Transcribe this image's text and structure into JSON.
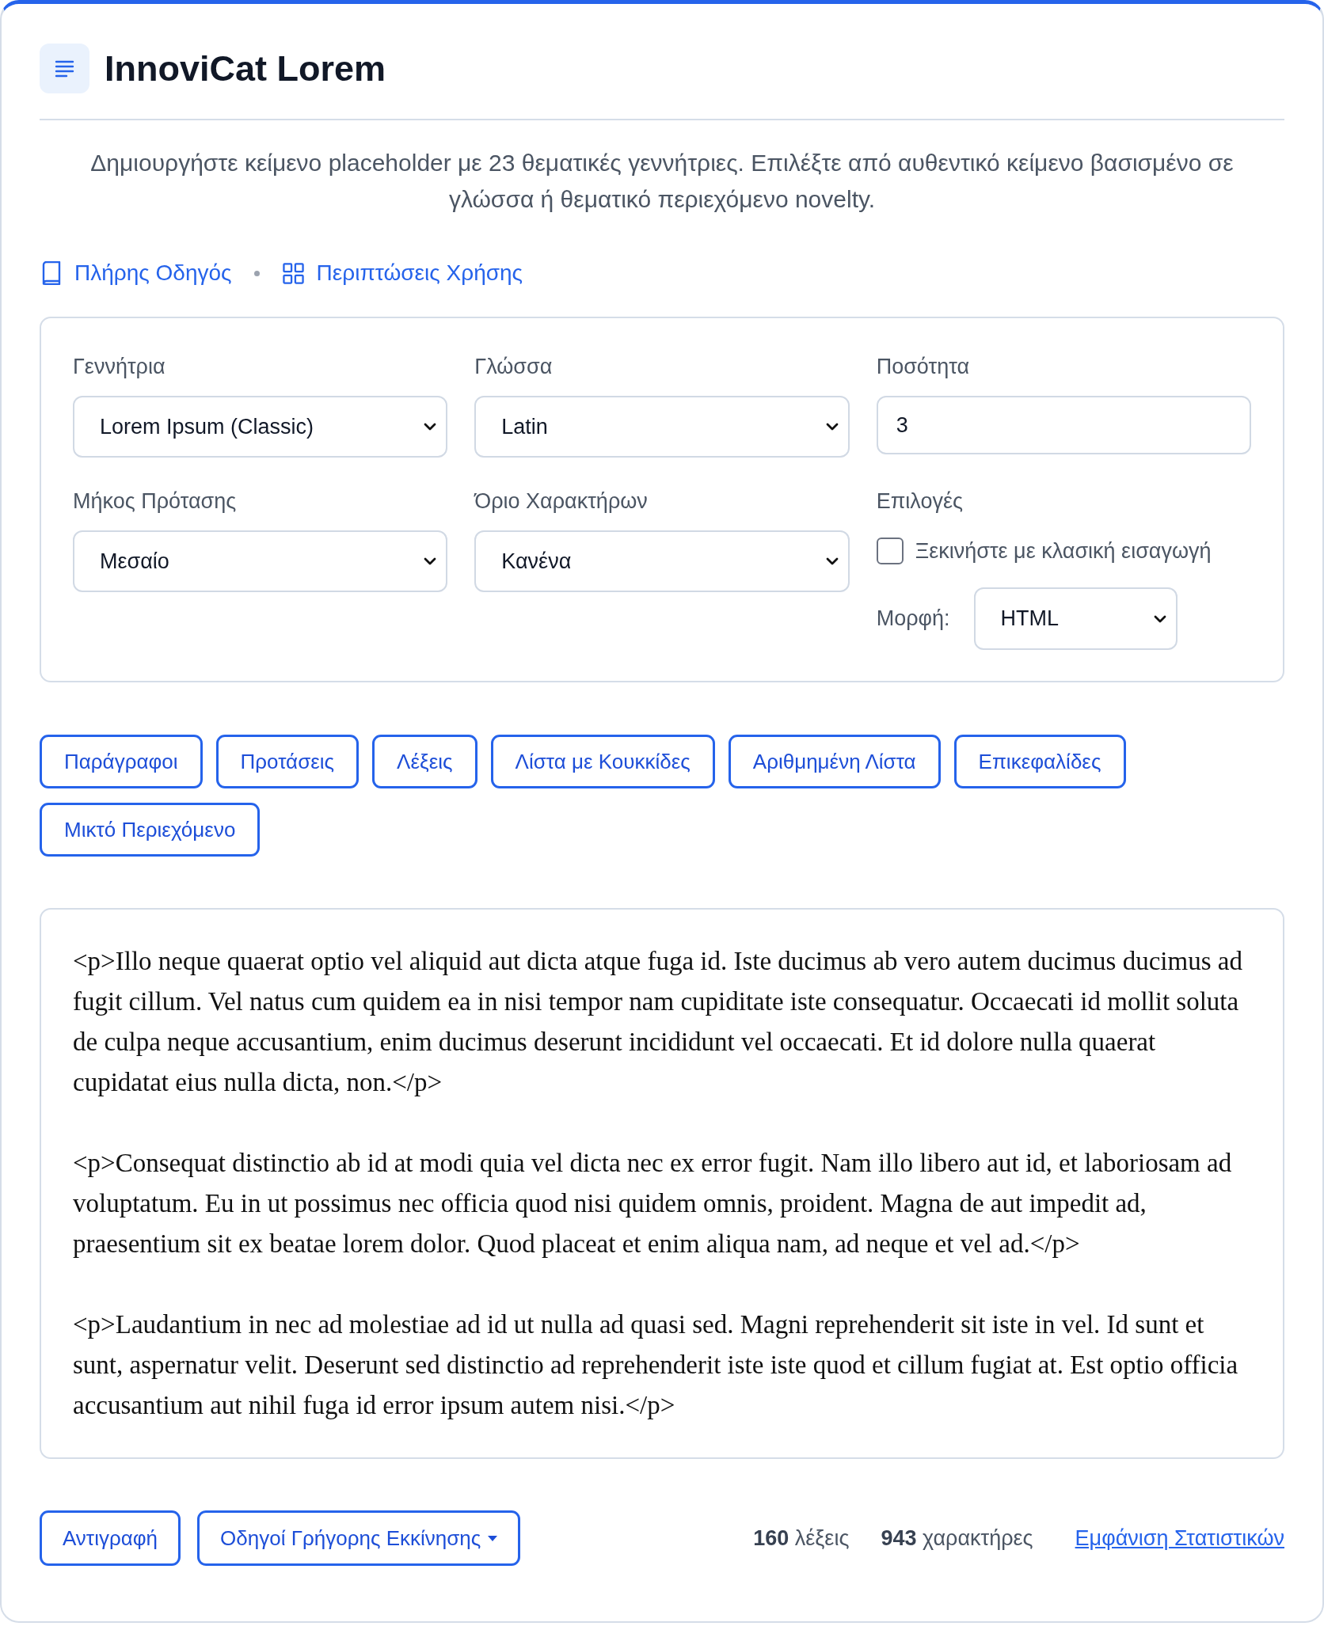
{
  "header": {
    "title": "InnoviCat Lorem"
  },
  "description": "Δημιουργήστε κείμενο placeholder με 23 θεματικές γεννήτριες. Επιλέξτε από αυθεντικό κείμενο βασισμένο σε γλώσσα ή θεματικό περιεχόμενο novelty.",
  "links": [
    {
      "kind": "guide",
      "label": "Πλήρης Οδηγός"
    },
    {
      "kind": "cases",
      "label": "Περιπτώσεις Χρήσης"
    }
  ],
  "settings": {
    "fields": [
      {
        "kind": "select",
        "label": "Γεννήτρια",
        "value": "Lorem Ipsum (Classic)"
      },
      {
        "kind": "select",
        "label": "Γλώσσα",
        "value": "Latin"
      },
      {
        "kind": "number",
        "label": "Ποσότητα",
        "value": "3"
      },
      {
        "kind": "select",
        "label": "Μήκος Πρότασης",
        "value": "Μεσαίο"
      },
      {
        "kind": "select",
        "label": "Όριο Χαρακτήρων",
        "value": "Κανένα"
      },
      {
        "kind": "options",
        "label": "Επιλογές",
        "checkbox": {
          "label": "Ξεκινήστε με κλασική εισαγωγή",
          "checked": false
        },
        "format": {
          "label": "Μορφή:",
          "value": "HTML"
        }
      }
    ]
  },
  "generate_buttons": [
    "Παράγραφοι",
    "Προτάσεις",
    "Λέξεις",
    "Λίστα με Κουκκίδες",
    "Αριθμημένη Λίστα",
    "Επικεφαλίδες",
    "Μικτό Περιεχόμενο"
  ],
  "output": {
    "paragraphs": [
      "<p>Illo neque quaerat optio vel aliquid aut dicta atque fuga id. Iste ducimus ab vero autem ducimus ducimus ad fugit cillum. Vel natus cum quidem ea in nisi tempor nam cupiditate iste consequatur. Occaecati id mollit soluta de culpa neque accusantium, enim ducimus deserunt incididunt vel occaecati. Et id dolore nulla quaerat cupidatat eius nulla dicta, non.</p>",
      "<p>Consequat distinctio ab id at modi quia vel dicta nec ex error fugit. Nam illo libero aut id, et laboriosam ad voluptatum. Eu in ut possimus nec officia quod nisi quidem omnis, proident. Magna de aut impedit ad, praesentium sit ex beatae lorem dolor. Quod placeat et enim aliqua nam, ad neque et vel ad.</p>",
      "<p>Laudantium in nec ad molestiae ad id ut nulla ad quasi sed. Magni reprehenderit sit iste in vel. Id sunt et sunt, aspernatur velit. Deserunt sed distinctio ad reprehenderit iste iste quod et cillum fugiat at. Est optio officia accusantium aut nihil fuga id error ipsum autem nisi.</p>"
    ]
  },
  "footer": {
    "buttons": [
      {
        "label": "Αντιγραφή",
        "dropdown": false
      },
      {
        "label": "Οδηγοί Γρήγορης Εκκίνησης",
        "dropdown": true
      }
    ],
    "stats": [
      "**160** λέξεις",
      "**943** χαρακτήρες"
    ],
    "link": "Εμφάνιση Στατιστικών"
  }
}
